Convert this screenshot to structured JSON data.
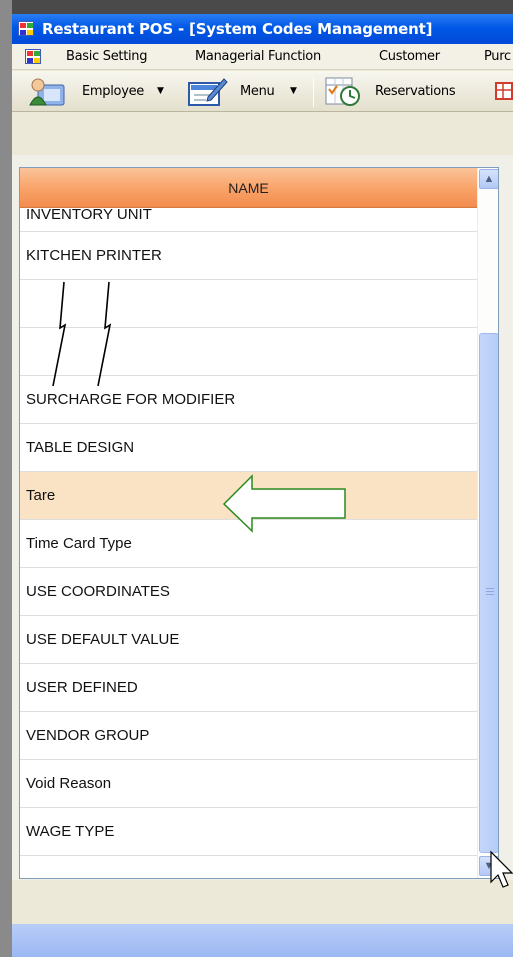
{
  "window": {
    "title": "Restaurant POS - [System Codes Management]"
  },
  "menubar": {
    "items": [
      "Basic Setting",
      "Managerial Function",
      "Customer",
      "Purc"
    ]
  },
  "toolbar": {
    "buttons": [
      {
        "label": "Employee",
        "icon": "employee-icon",
        "dropdown": true
      },
      {
        "label": "Menu",
        "icon": "menu-edit-icon",
        "dropdown": true
      },
      {
        "label": "Reservations",
        "icon": "reservations-icon",
        "dropdown": false
      }
    ]
  },
  "grid": {
    "column_header": "NAME",
    "rows_top": [
      "INVENTORY UNIT",
      "KITCHEN PRINTER"
    ],
    "rows_bottom": [
      "SURCHARGE FOR MODIFIER",
      "TABLE DESIGN",
      "Tare",
      "Time Card Type",
      "USE COORDINATES",
      "USE DEFAULT VALUE",
      "USER DEFINED",
      "VENDOR GROUP",
      "Void Reason",
      "WAGE TYPE"
    ],
    "selected_row": "Tare"
  },
  "colors": {
    "header_orange": "#f9a46a",
    "selected_row": "#fae3c4",
    "annotation_arrow": "#2a8a1e",
    "titlebar_blue": "#0058e6"
  }
}
